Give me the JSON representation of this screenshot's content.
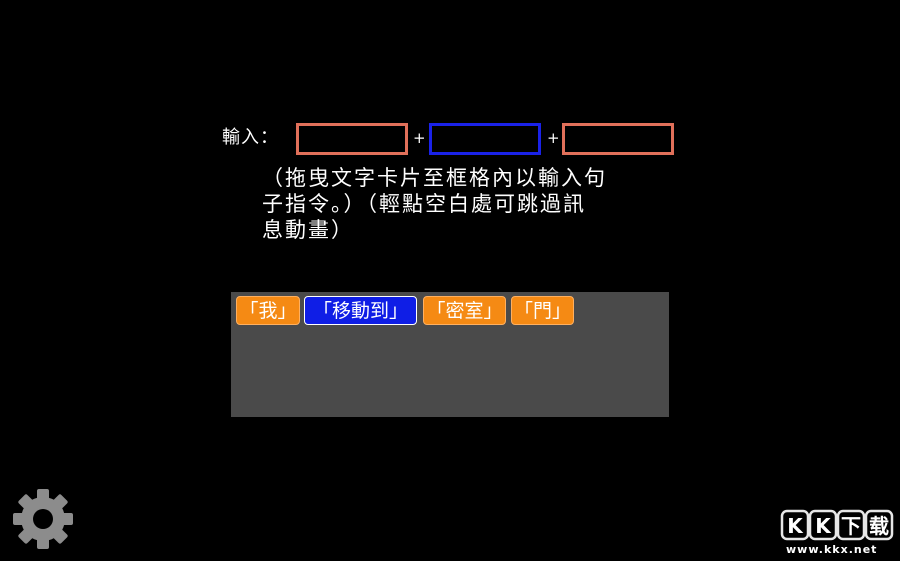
{
  "sentence": {
    "label": "輸入：",
    "plus_sign": "+"
  },
  "instructions": {
    "lines": [
      "（拖曳文字卡片至框格內以輸入句",
      "子指令。）（輕點空白處可跳過訊",
      "息動畫）"
    ]
  },
  "word_cards": [
    {
      "text": "「我」",
      "kind": "noun"
    },
    {
      "text": "「移動到」",
      "kind": "verb"
    },
    {
      "text": "「密室」",
      "kind": "noun"
    },
    {
      "text": "「門」",
      "kind": "noun"
    }
  ],
  "settings": {
    "icon": "gear-icon"
  },
  "watermark": {
    "logo_text": "KK下载",
    "url": "www.kkx.net"
  },
  "colors": {
    "noun_card": "#f58a14",
    "verb_card": "#0f1ee6",
    "noun_slot_border": "#e0705a",
    "verb_slot_border": "#1a22e8",
    "tray": "#4a4a4a",
    "background": "#000000"
  }
}
